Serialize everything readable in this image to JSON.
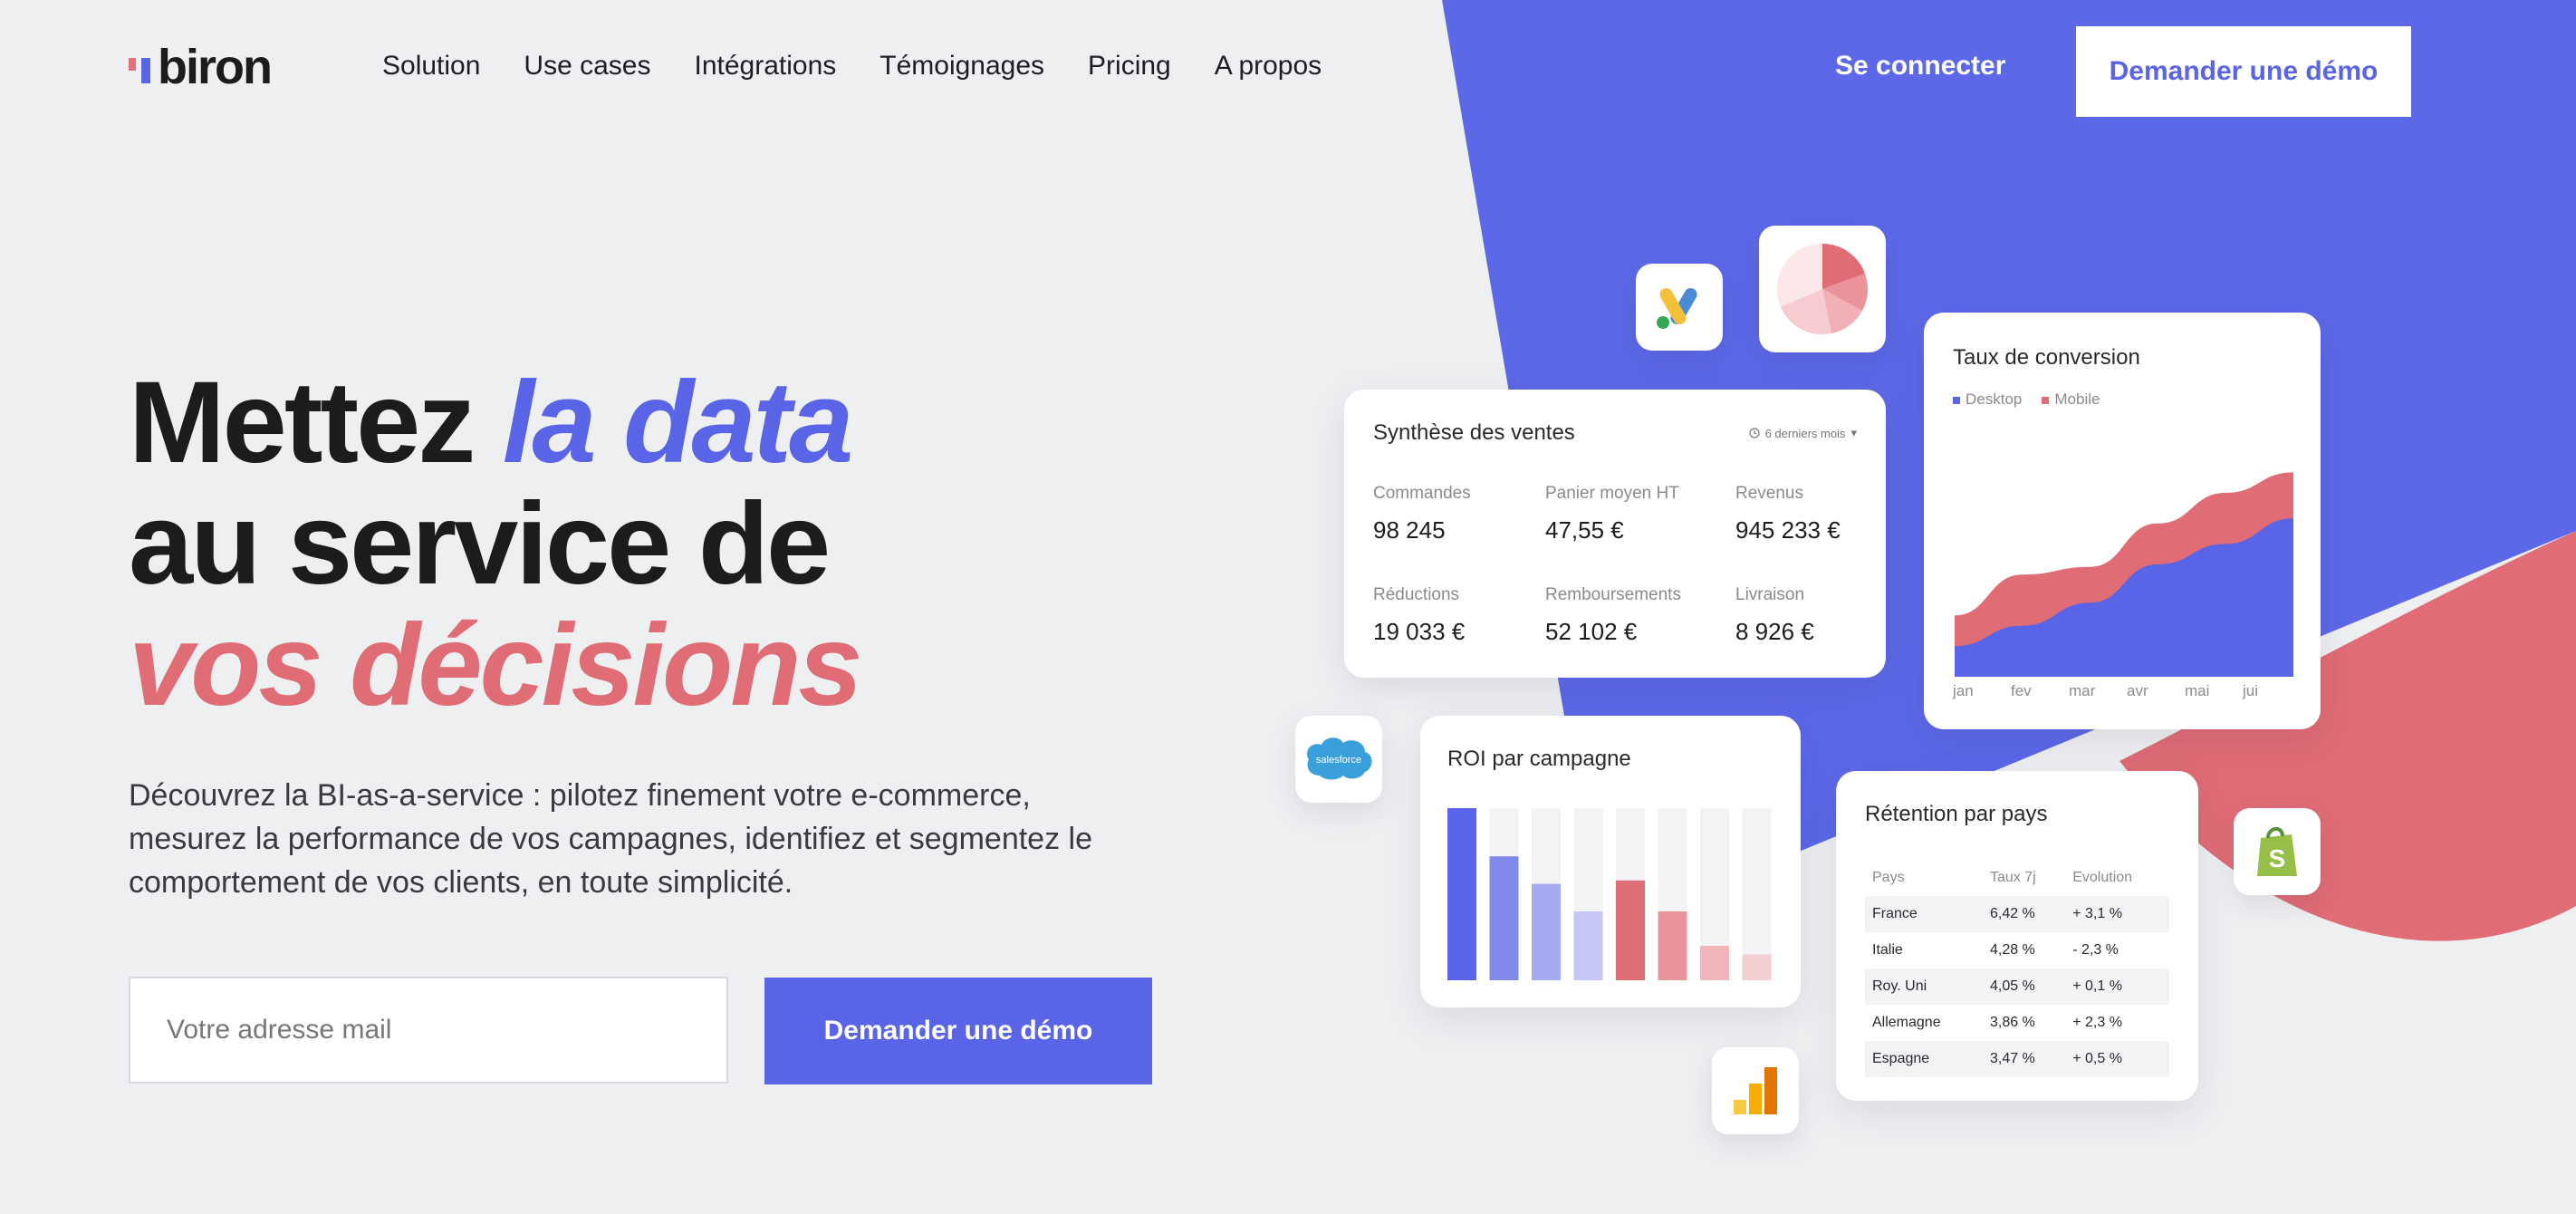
{
  "brand": {
    "name": "biron",
    "accent": "#5a64e6",
    "accent2": "#e06c75"
  },
  "nav": {
    "items": [
      "Solution",
      "Use cases",
      "Intégrations",
      "Témoignages",
      "Pricing",
      "A propos"
    ]
  },
  "header": {
    "login": "Se connecter",
    "demo": "Demander une démo"
  },
  "hero": {
    "line1_a": "Mettez ",
    "line1_b": "la data",
    "line2": "au service de",
    "line3": "vos décisions",
    "subtitle": "Découvrez la BI-as-a-service : pilotez finement votre e-commerce, mesurez la performance de vos campagnes, identifiez et segmentez le comportement de vos clients, en toute simplicité.",
    "email_placeholder": "Votre adresse mail",
    "cta": "Demander une démo"
  },
  "sales_card": {
    "title": "Synthèse des ventes",
    "period": "6 derniers mois",
    "kpis": [
      {
        "label": "Commandes",
        "value": "98 245"
      },
      {
        "label": "Panier moyen HT",
        "value": "47,55 €"
      },
      {
        "label": "Revenus",
        "value": "945 233 €"
      },
      {
        "label": "Réductions",
        "value": "19 033 €"
      },
      {
        "label": "Remboursements",
        "value": "52 102 €"
      },
      {
        "label": "Livraison",
        "value": "8 926 €"
      }
    ]
  },
  "conversion_card": {
    "title": "Taux de conversion",
    "legend": [
      "Desktop",
      "Mobile"
    ],
    "months": [
      "jan",
      "fev",
      "mar",
      "avr",
      "mai",
      "jui"
    ],
    "chart_data": {
      "type": "area",
      "x": [
        "jan",
        "fev",
        "mar",
        "avr",
        "mai",
        "jui"
      ],
      "series": [
        {
          "name": "Desktop",
          "values": [
            12,
            20,
            29,
            44,
            52,
            62
          ]
        },
        {
          "name": "Mobile",
          "values": [
            24,
            40,
            43,
            60,
            72,
            80
          ]
        }
      ],
      "ylim": [
        0,
        100
      ],
      "legend_position": "top-left"
    }
  },
  "roi_card": {
    "title": "ROI par campagne",
    "chart_data": {
      "type": "bar",
      "values": [
        100,
        72,
        56,
        40,
        58,
        40,
        20,
        15
      ],
      "ylim": [
        0,
        100
      ]
    }
  },
  "retention_card": {
    "title": "Rétention par pays",
    "columns": [
      "Pays",
      "Taux 7j",
      "Evolution"
    ],
    "rows": [
      [
        "France",
        "6,42 %",
        "+ 3,1 %"
      ],
      [
        "Italie",
        "4,28 %",
        "- 2,3 %"
      ],
      [
        "Roy. Uni",
        "4,05 %",
        "+ 0,1 %"
      ],
      [
        "Allemagne",
        "3,86 %",
        "+ 2,3 %"
      ],
      [
        "Espagne",
        "3,47 %",
        "+ 0,5 %"
      ]
    ]
  },
  "icons": {
    "ads": "google-ads-icon",
    "pie": "pie-chart-icon",
    "salesforce": "salesforce-icon",
    "shopify": "shopify-icon",
    "analytics": "google-analytics-icon"
  },
  "logos": {
    "salesforce_text": "salesforce"
  }
}
